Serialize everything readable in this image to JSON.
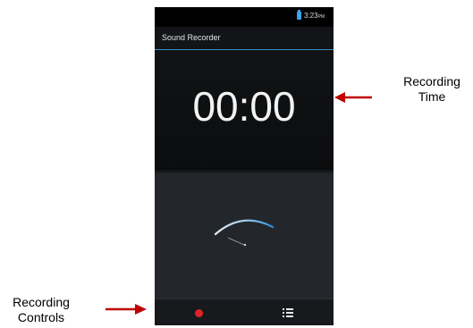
{
  "status_bar": {
    "time": "3:23",
    "ampm": "PM"
  },
  "app": {
    "title": "Sound Recorder"
  },
  "recorder": {
    "elapsed_time": "00:00"
  },
  "controls": {
    "record": "record-icon",
    "list": "list-icon"
  },
  "annotations": {
    "time_label_line1": "Recording",
    "time_label_line2": "Time",
    "controls_label_line1": "Recording",
    "controls_label_line2": "Controls"
  },
  "colors": {
    "accent": "#3a8fc6",
    "record": "#e0232a",
    "arrow": "#c00000"
  }
}
